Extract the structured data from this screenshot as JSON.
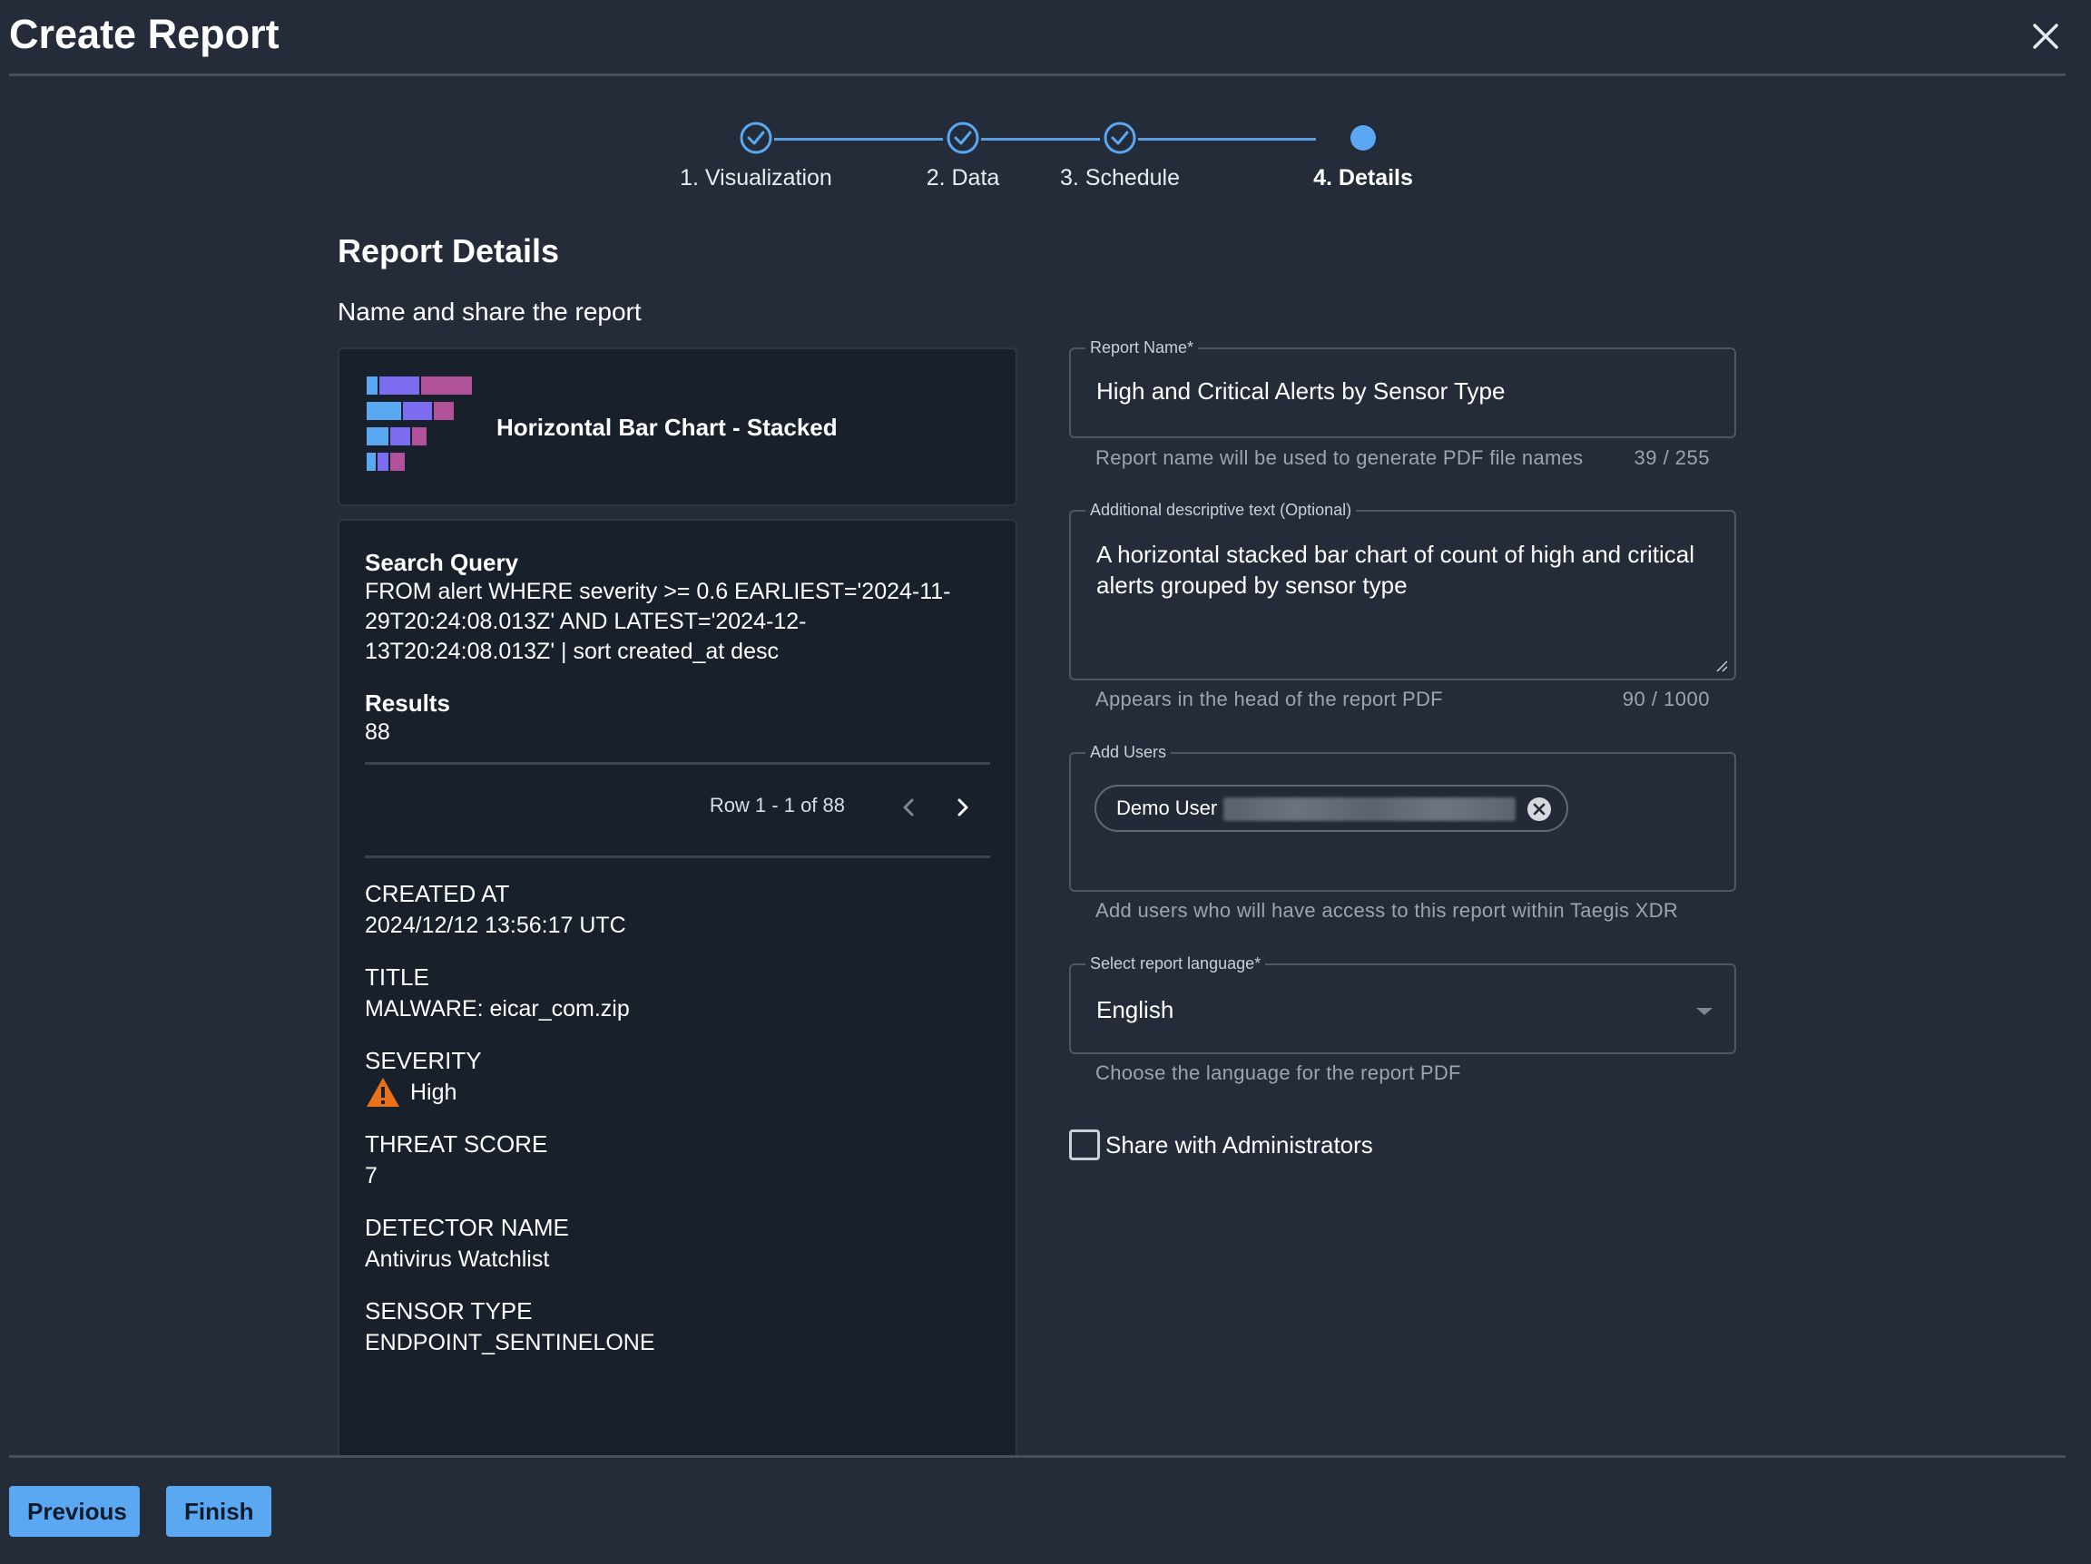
{
  "window": {
    "title": "Create Report"
  },
  "stepper": {
    "steps": [
      {
        "label": "1. Visualization",
        "status": "complete"
      },
      {
        "label": "2. Data",
        "status": "complete"
      },
      {
        "label": "3. Schedule",
        "status": "complete"
      },
      {
        "label": "4. Details",
        "status": "active"
      }
    ]
  },
  "section": {
    "title": "Report Details",
    "subtitle": "Name and share the report"
  },
  "chart_card": {
    "label": "Horizontal Bar Chart - Stacked",
    "icon": "stacked-bar-chart-icon"
  },
  "query": {
    "label": "Search Query",
    "text": "FROM alert WHERE severity >= 0.6 EARLIEST='2024-11-29T20:24:08.013Z' AND LATEST='2024-12-13T20:24:08.013Z' | sort created_at desc",
    "results_label": "Results",
    "results_value": "88",
    "pager_text": "Row 1 - 1 of 88",
    "fields": [
      {
        "label": "CREATED AT",
        "value": "2024/12/12 13:56:17 UTC"
      },
      {
        "label": "TITLE",
        "value": "MALWARE: eicar_com.zip"
      },
      {
        "label": "SEVERITY",
        "value": "High"
      },
      {
        "label": "THREAT SCORE",
        "value": "7"
      },
      {
        "label": "DETECTOR NAME",
        "value": "Antivirus Watchlist"
      },
      {
        "label": "SENSOR TYPE",
        "value": "ENDPOINT_SENTINELONE"
      }
    ]
  },
  "form": {
    "report_name": {
      "label": "Report Name*",
      "value": "High and Critical Alerts by Sensor Type",
      "helper": "Report name will be used to generate PDF file names",
      "counter": "39 / 255"
    },
    "description": {
      "label": "Additional descriptive text (Optional)",
      "value": "A horizontal stacked bar chart of count of high and critical alerts grouped by sensor type",
      "helper": "Appears in the head of the report PDF",
      "counter": "90 / 1000"
    },
    "users": {
      "label": "Add Users",
      "chip_name": "Demo User",
      "helper": "Add users who will have access to this report within Taegis XDR"
    },
    "language": {
      "label": "Select report language*",
      "value": "English",
      "helper": "Choose the language for the report PDF"
    },
    "share": {
      "label": "Share with Administrators",
      "checked": false
    }
  },
  "footer": {
    "previous_label": "Previous",
    "finish_label": "Finish"
  },
  "colors": {
    "accent": "#5ba8f2",
    "background": "#232c38",
    "card": "#17202b",
    "warning": "#e8711a"
  }
}
